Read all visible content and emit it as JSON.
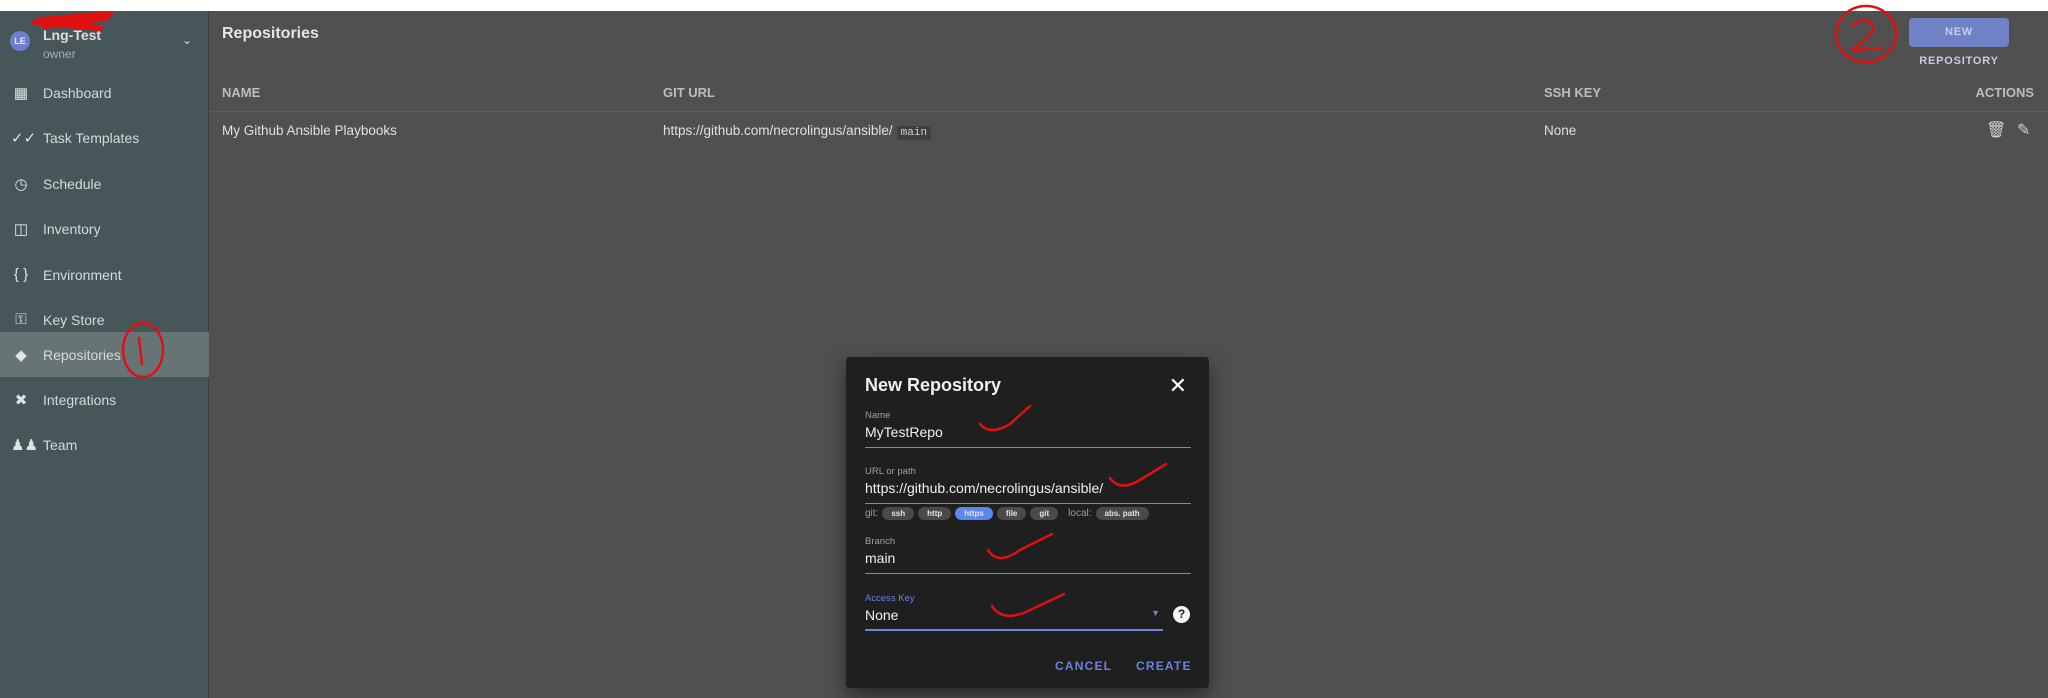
{
  "user": {
    "initials": "LE",
    "name": "Lng-Test",
    "role": "owner"
  },
  "sidebar": {
    "items": [
      {
        "label": "Dashboard",
        "icon": "dashboard-icon"
      },
      {
        "label": "Task Templates",
        "icon": "double-check-icon"
      },
      {
        "label": "Schedule",
        "icon": "clock-icon"
      },
      {
        "label": "Inventory",
        "icon": "monitor-icon"
      },
      {
        "label": "Environment",
        "icon": "braces-icon"
      },
      {
        "label": "Key Store",
        "icon": "key-icon"
      },
      {
        "label": "Repositories",
        "icon": "git-icon",
        "active": true
      },
      {
        "label": "Integrations",
        "icon": "plug-icon"
      },
      {
        "label": "Team",
        "icon": "people-icon"
      }
    ]
  },
  "header": {
    "title": "Repositories",
    "new_button": "NEW REPOSITORY"
  },
  "table": {
    "columns": [
      "NAME",
      "GIT URL",
      "SSH KEY",
      "ACTIONS"
    ],
    "rows": [
      {
        "name": "My Github Ansible Playbooks",
        "url": "https://github.com/necrolingus/ansible/",
        "branch": "main",
        "ssh_key": "None"
      }
    ]
  },
  "dialog": {
    "title": "New Repository",
    "name": {
      "label": "Name",
      "value": "MyTestRepo"
    },
    "url": {
      "label": "URL or path",
      "value": "https://github.com/necrolingus/ansible/"
    },
    "git_prefix": "git:",
    "git_chips": [
      "ssh",
      "http",
      "https",
      "file",
      "git"
    ],
    "selected_chip": "https",
    "local_prefix": "local:",
    "local_chip": "abs. path",
    "branch": {
      "label": "Branch",
      "value": "main"
    },
    "access_key": {
      "label": "Access Key",
      "value": "None"
    },
    "help": "?",
    "cancel": "CANCEL",
    "create": "CREATE"
  },
  "colors": {
    "accent": "#6c82dd",
    "sidebar": "#475659",
    "main": "#505050",
    "dialog": "#1f1f1f"
  }
}
